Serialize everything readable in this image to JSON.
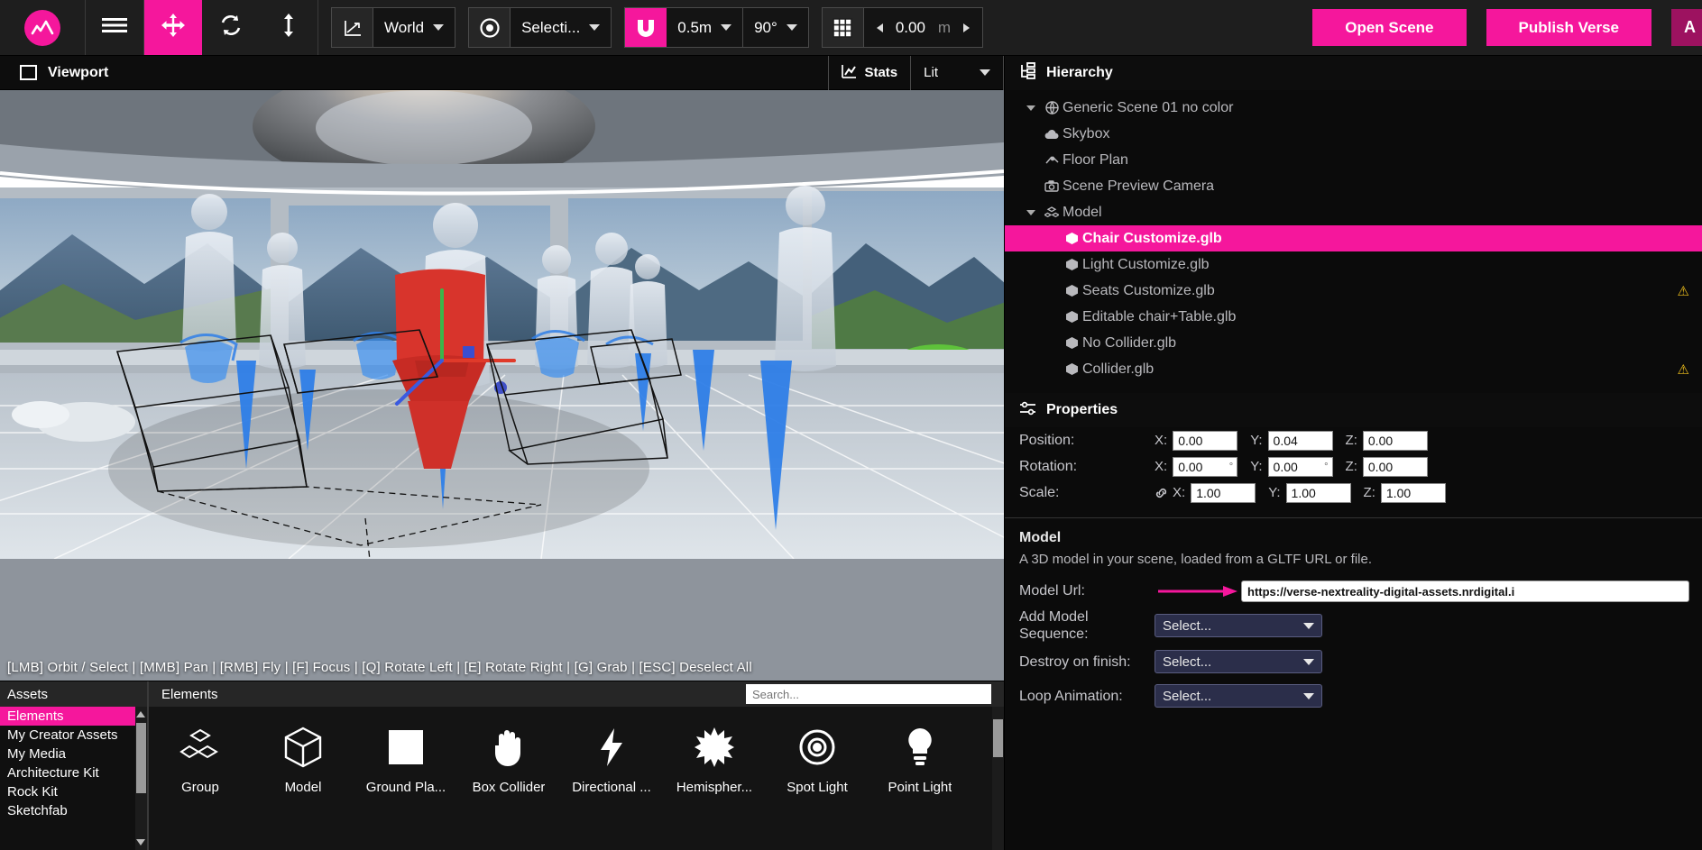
{
  "app": {
    "brand_accent": "#f5179c",
    "logo_icon": "mountain-logo-icon"
  },
  "toolbar": {
    "menu_icon": "hamburger-menu-icon",
    "move_icon": "move-tool-icon",
    "rotate_icon": "rotate-tool-icon",
    "scale_icon": "scale-tool-icon",
    "coord_icon": "axis-gizmo-icon",
    "coord_space": "World",
    "pivot_icon": "target-pivot-icon",
    "pivot_mode": "Selecti...",
    "snap_icon": "magnet-snap-icon",
    "snap_translate": "0.5m",
    "snap_rotate": "90°",
    "grid_icon": "grid-icon",
    "grid_height": "0.00",
    "grid_unit": "m",
    "open_scene": "Open Scene",
    "publish_verse": "Publish Verse",
    "account_initial": "A"
  },
  "viewport": {
    "panel_icon": "viewport-frame-icon",
    "title": "Viewport",
    "stats_icon": "stats-chart-icon",
    "stats_label": "Stats",
    "shading_mode": "Lit",
    "hint": "[LMB] Orbit / Select | [MMB] Pan | [RMB] Fly | [F] Focus | [Q] Rotate Left | [E] Rotate Right | [G] Grab | [ESC] Deselect All"
  },
  "hierarchy": {
    "panel_icon": "hierarchy-tree-icon",
    "title": "Hierarchy",
    "items": [
      {
        "label": "Generic Scene 01 no color",
        "icon": "globe-icon",
        "depth": 0,
        "expanded": true,
        "selected": false,
        "warning": false
      },
      {
        "label": "Skybox",
        "icon": "cloud-icon",
        "depth": 1,
        "expanded": null,
        "selected": false,
        "warning": false
      },
      {
        "label": "Floor Plan",
        "icon": "floorplan-icon",
        "depth": 1,
        "expanded": null,
        "selected": false,
        "warning": false
      },
      {
        "label": "Scene Preview Camera",
        "icon": "camera-icon",
        "depth": 1,
        "expanded": null,
        "selected": false,
        "warning": false
      },
      {
        "label": "Model",
        "icon": "group-cubes-icon",
        "depth": 1,
        "expanded": true,
        "selected": false,
        "warning": false
      },
      {
        "label": "Chair Customize.glb",
        "icon": "cube-icon",
        "depth": 2,
        "expanded": null,
        "selected": true,
        "warning": false
      },
      {
        "label": "Light Customize.glb",
        "icon": "cube-icon",
        "depth": 2,
        "expanded": null,
        "selected": false,
        "warning": false
      },
      {
        "label": "Seats Customize.glb",
        "icon": "cube-icon",
        "depth": 2,
        "expanded": null,
        "selected": false,
        "warning": true
      },
      {
        "label": "Editable chair+Table.glb",
        "icon": "cube-icon",
        "depth": 2,
        "expanded": null,
        "selected": false,
        "warning": false
      },
      {
        "label": "No Collider.glb",
        "icon": "cube-icon",
        "depth": 2,
        "expanded": null,
        "selected": false,
        "warning": false
      },
      {
        "label": "Collider.glb",
        "icon": "cube-icon",
        "depth": 2,
        "expanded": null,
        "selected": false,
        "warning": true
      }
    ],
    "warning_glyph": "⚠"
  },
  "properties": {
    "panel_icon": "sliders-icon",
    "title": "Properties",
    "transform": [
      {
        "label": "Position:",
        "x": "0.00",
        "y": "0.04",
        "z": "0.00",
        "unit": "",
        "linked": false
      },
      {
        "label": "Rotation:",
        "x": "0.00",
        "y": "0.00",
        "z": "0.00",
        "unit": "°",
        "linked": false
      },
      {
        "label": "Scale:",
        "x": "1.00",
        "y": "1.00",
        "z": "1.00",
        "unit": "",
        "linked": true
      }
    ],
    "axis_labels": {
      "x": "X:",
      "y": "Y:",
      "z": "Z:"
    },
    "link_icon": "chain-link-icon"
  },
  "model_section": {
    "title": "Model",
    "description": "A 3D model in your scene, loaded from a GLTF URL or file.",
    "fields": [
      {
        "label": "Model Url:",
        "type": "text",
        "value": "https://verse-nextreality-digital-assets.nrdigital.i",
        "annotated": true
      },
      {
        "label": "Add Model Sequence:",
        "type": "select",
        "value": "Select...",
        "annotated": false
      },
      {
        "label": "Destroy on finish:",
        "type": "select",
        "value": "Select...",
        "annotated": false
      },
      {
        "label": "Loop Animation:",
        "type": "select",
        "value": "Select...",
        "annotated": false
      }
    ],
    "annotation_arrow_color": "#f5179c"
  },
  "assets": {
    "panel_title": "Assets",
    "categories": [
      {
        "label": "Elements",
        "selected": true
      },
      {
        "label": "My Creator Assets",
        "selected": false
      },
      {
        "label": "My Media",
        "selected": false
      },
      {
        "label": "Architecture Kit",
        "selected": false
      },
      {
        "label": "Rock Kit",
        "selected": false
      },
      {
        "label": "Sketchfab",
        "selected": false
      }
    ],
    "content_title": "Elements",
    "search_placeholder": "Search...",
    "search_value": "",
    "elements": [
      {
        "label": "Group",
        "icon": "group-cubes-icon"
      },
      {
        "label": "Model",
        "icon": "cube-outline-icon"
      },
      {
        "label": "Ground Pla...",
        "icon": "ground-plane-icon"
      },
      {
        "label": "Box Collider",
        "icon": "hand-collider-icon"
      },
      {
        "label": "Directional ...",
        "icon": "lightning-bolt-icon"
      },
      {
        "label": "Hemispher...",
        "icon": "sunburst-icon"
      },
      {
        "label": "Spot Light",
        "icon": "spotlight-target-icon"
      },
      {
        "label": "Point Light",
        "icon": "lightbulb-icon"
      }
    ]
  }
}
